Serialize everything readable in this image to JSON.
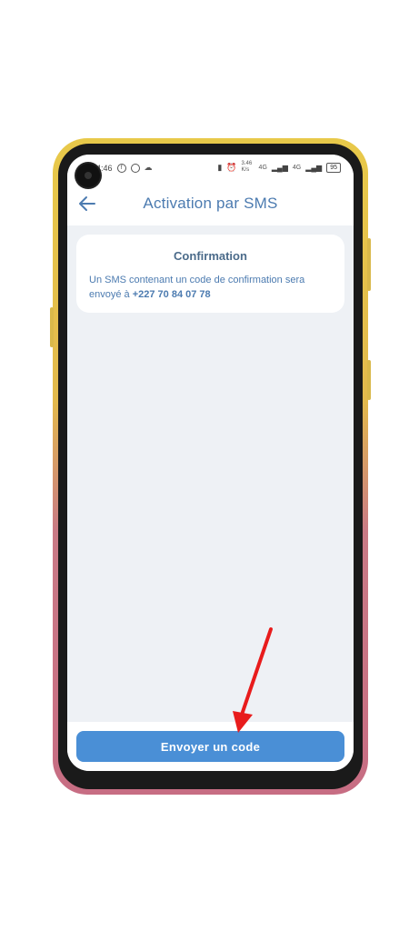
{
  "status_bar": {
    "time": "4:46",
    "net_speed": "3.46 K/s",
    "net_1": "4G",
    "net_2": "4G",
    "battery": "95"
  },
  "app_bar": {
    "title": "Activation par SMS",
    "back_icon": "arrow-left-icon"
  },
  "card": {
    "title": "Confirmation",
    "message": "Un SMS contenant un code de confirmation sera envoyé à",
    "phone": "+227 70 84 07 78"
  },
  "action": {
    "send_label": "Envoyer un code"
  },
  "colors": {
    "accent": "#4a8fd6",
    "title": "#4c7bb0",
    "annotation_arrow": "#e81c1c"
  }
}
